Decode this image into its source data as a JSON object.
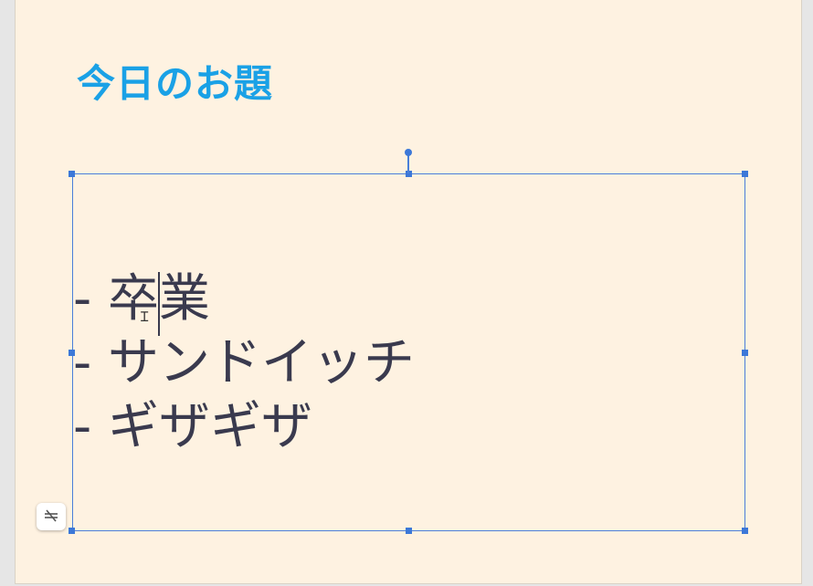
{
  "slide": {
    "title": "今日のお題",
    "body_lines": [
      "- 卒業",
      "- サンドイッチ",
      "- ギザギザ"
    ]
  },
  "icons": {
    "autofit": "text-autofit-off-icon",
    "cursor": "ibeam-cursor-icon"
  },
  "colors": {
    "slide_background": "#fef2e1",
    "title": "#1aa1e6",
    "body_text": "#3a3a4e",
    "selection": "#3c78d8"
  }
}
